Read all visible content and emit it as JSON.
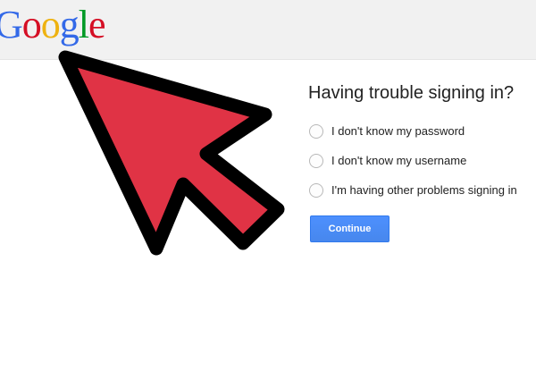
{
  "header": {
    "logo_letters": [
      {
        "char": "G",
        "color": "#3369e8"
      },
      {
        "char": "o",
        "color": "#d50f25"
      },
      {
        "char": "o",
        "color": "#eeb211"
      },
      {
        "char": "g",
        "color": "#3369e8"
      },
      {
        "char": "l",
        "color": "#009925"
      },
      {
        "char": "e",
        "color": "#d50f25"
      }
    ]
  },
  "main": {
    "title": "Having trouble signing in?",
    "options": [
      {
        "label": "I don't know my password"
      },
      {
        "label": "I don't know my username"
      },
      {
        "label": "I'm having other problems signing in"
      }
    ],
    "continue_label": "Continue"
  },
  "overlay": {
    "icon": "pointer-arrow-icon",
    "fill_color": "#e03345",
    "stroke_color": "#000000"
  },
  "colors": {
    "header_bg": "#f1f1f1",
    "button_blue": "#4d90fe"
  }
}
